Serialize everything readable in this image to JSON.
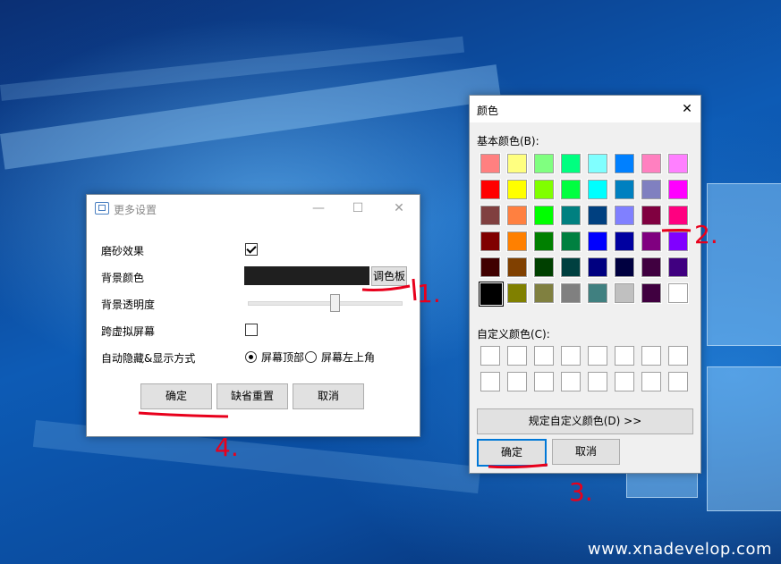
{
  "watermark": "www.xnadevelop.com",
  "colors": {
    "annotation": "#e8001c",
    "accent": "#0078d7"
  },
  "settings_window": {
    "title": "更多设置",
    "icon": "monitor-icon",
    "rows": {
      "frosted": {
        "label": "磨砂效果",
        "checked": true
      },
      "bgcolor": {
        "label": "背景颜色",
        "value_color": "#1f1f1f",
        "palette_button": "调色板"
      },
      "opacity": {
        "label": "背景透明度",
        "level": 0.57
      },
      "span_screens": {
        "label": "跨虚拟屏幕",
        "checked": false
      },
      "autohide": {
        "label": "自动隐藏&显示方式",
        "options": [
          "屏幕顶部",
          "屏幕左上角"
        ],
        "selected": "屏幕顶部"
      }
    },
    "buttons": {
      "ok": "确定",
      "reset": "缺省重置",
      "cancel": "取消"
    }
  },
  "color_dialog": {
    "title": "颜色",
    "basic_label": "基本颜色(B):",
    "custom_label": "自定义颜色(C):",
    "define_button": "规定自定义颜色(D) >>",
    "ok": "确定",
    "cancel": "取消",
    "selected_index": 40,
    "basic_colors": [
      "#ff8080",
      "#ffff80",
      "#80ff80",
      "#00ff80",
      "#80ffff",
      "#0080ff",
      "#ff80c0",
      "#ff80ff",
      "#ff0000",
      "#ffff00",
      "#80ff00",
      "#00ff40",
      "#00ffff",
      "#0080c0",
      "#8080c0",
      "#ff00ff",
      "#804040",
      "#ff8040",
      "#00ff00",
      "#008080",
      "#004080",
      "#8080ff",
      "#800040",
      "#ff0080",
      "#800000",
      "#ff8000",
      "#008000",
      "#008040",
      "#0000ff",
      "#0000a0",
      "#800080",
      "#8000ff",
      "#400000",
      "#804000",
      "#004000",
      "#004040",
      "#000080",
      "#000040",
      "#400040",
      "#400080",
      "#000000",
      "#808000",
      "#808040",
      "#808080",
      "#408080",
      "#c0c0c0",
      "#400040",
      "#ffffff"
    ],
    "custom_colors": [
      "#ffffff",
      "#ffffff",
      "#ffffff",
      "#ffffff",
      "#ffffff",
      "#ffffff",
      "#ffffff",
      "#ffffff",
      "#ffffff",
      "#ffffff",
      "#ffffff",
      "#ffffff",
      "#ffffff",
      "#ffffff",
      "#ffffff",
      "#ffffff"
    ]
  },
  "annotations": [
    "1.",
    "2.",
    "3.",
    "4."
  ]
}
